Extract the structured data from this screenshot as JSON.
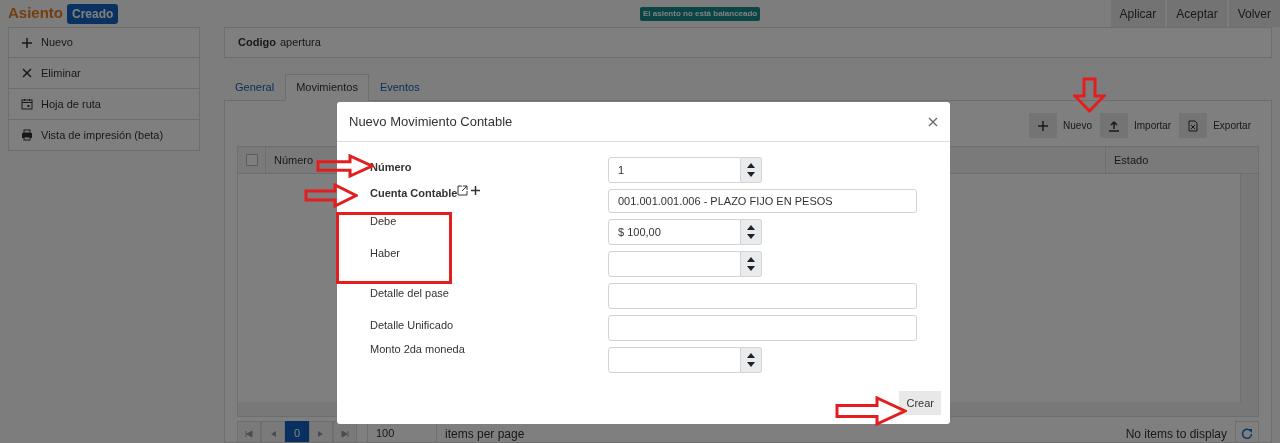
{
  "header": {
    "title": "Asiento",
    "status_badge": "Creado",
    "notice": "El asiento no está balanceado",
    "buttons": [
      "Aplicar",
      "Aceptar",
      "Volver"
    ]
  },
  "sidebar": {
    "items": [
      {
        "label": "Nuevo",
        "kind": "plus"
      },
      {
        "label": "Eliminar",
        "kind": "times"
      },
      {
        "label": "Hoja de ruta",
        "kind": "calendar"
      },
      {
        "label": "Vista de impresión (beta)",
        "kind": "printer"
      }
    ]
  },
  "code_card": {
    "label": "Codigo",
    "value": "apertura"
  },
  "tabs": [
    {
      "label": "General",
      "selected": false
    },
    {
      "label": "Movimientos",
      "selected": true
    },
    {
      "label": "Eventos",
      "selected": false
    }
  ],
  "toolbar": [
    {
      "label": "Nuevo",
      "kind": "plus"
    },
    {
      "label": "Importar",
      "kind": "upload"
    },
    {
      "label": "Exportar",
      "kind": "excel"
    }
  ],
  "table": {
    "select_all_checked": false,
    "columns": [
      "Número",
      "Estado"
    ]
  },
  "pager": {
    "pages": [
      {
        "label": "0",
        "selected": true
      }
    ],
    "page_size": "100",
    "page_size_label": "items per page",
    "status": "No items to display"
  },
  "modal": {
    "title": "Nuevo Movimiento Contable",
    "fields": [
      {
        "label": "Número",
        "required": true,
        "kind": "number",
        "value": "1"
      },
      {
        "label": "Cuenta Contable",
        "required": true,
        "kind": "account",
        "value": "001.001.001.006 - PLAZO FIJO EN PESOS"
      },
      {
        "label": "Debe",
        "required": false,
        "kind": "number",
        "value": "$ 100,00"
      },
      {
        "label": "Haber",
        "required": false,
        "kind": "number"
      },
      {
        "label": "Detalle del pase",
        "required": false,
        "kind": "text"
      },
      {
        "label": "Detalle Unificado",
        "required": false,
        "kind": "text"
      },
      {
        "label": "Monto 2da moneda",
        "required": false,
        "kind": "number"
      }
    ],
    "submit": "Crear"
  }
}
